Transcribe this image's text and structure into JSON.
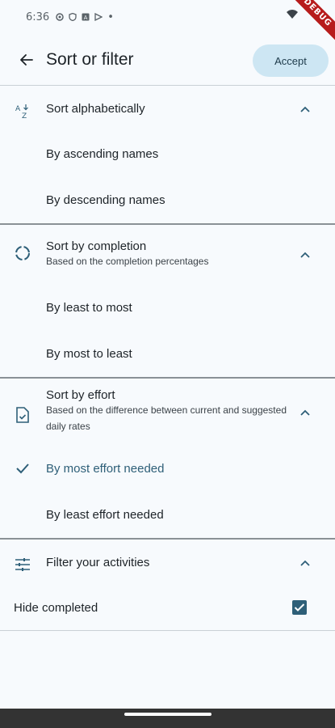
{
  "status": {
    "time": "6:36",
    "dot": "•",
    "debug": "DEBUG"
  },
  "header": {
    "title": "Sort or filter",
    "accept_label": "Accept"
  },
  "sections": {
    "alpha": {
      "title": "Sort alphabetically",
      "options": [
        "By ascending names",
        "By descending names"
      ]
    },
    "completion": {
      "title": "Sort by completion",
      "subtitle": "Based on the completion percentages",
      "options": [
        "By least to most",
        "By most to least"
      ]
    },
    "effort": {
      "title": "Sort by effort",
      "subtitle": "Based on the difference between current and suggested daily rates",
      "options": [
        "By most effort needed",
        "By least effort needed"
      ],
      "selected_index": 0
    },
    "filter": {
      "title": "Filter your activities",
      "hide_completed_label": "Hide completed",
      "hide_completed_checked": true
    }
  },
  "colors": {
    "accent": "#2e5f78",
    "accept_bg": "#cde6f3",
    "background": "#f7fafd"
  }
}
